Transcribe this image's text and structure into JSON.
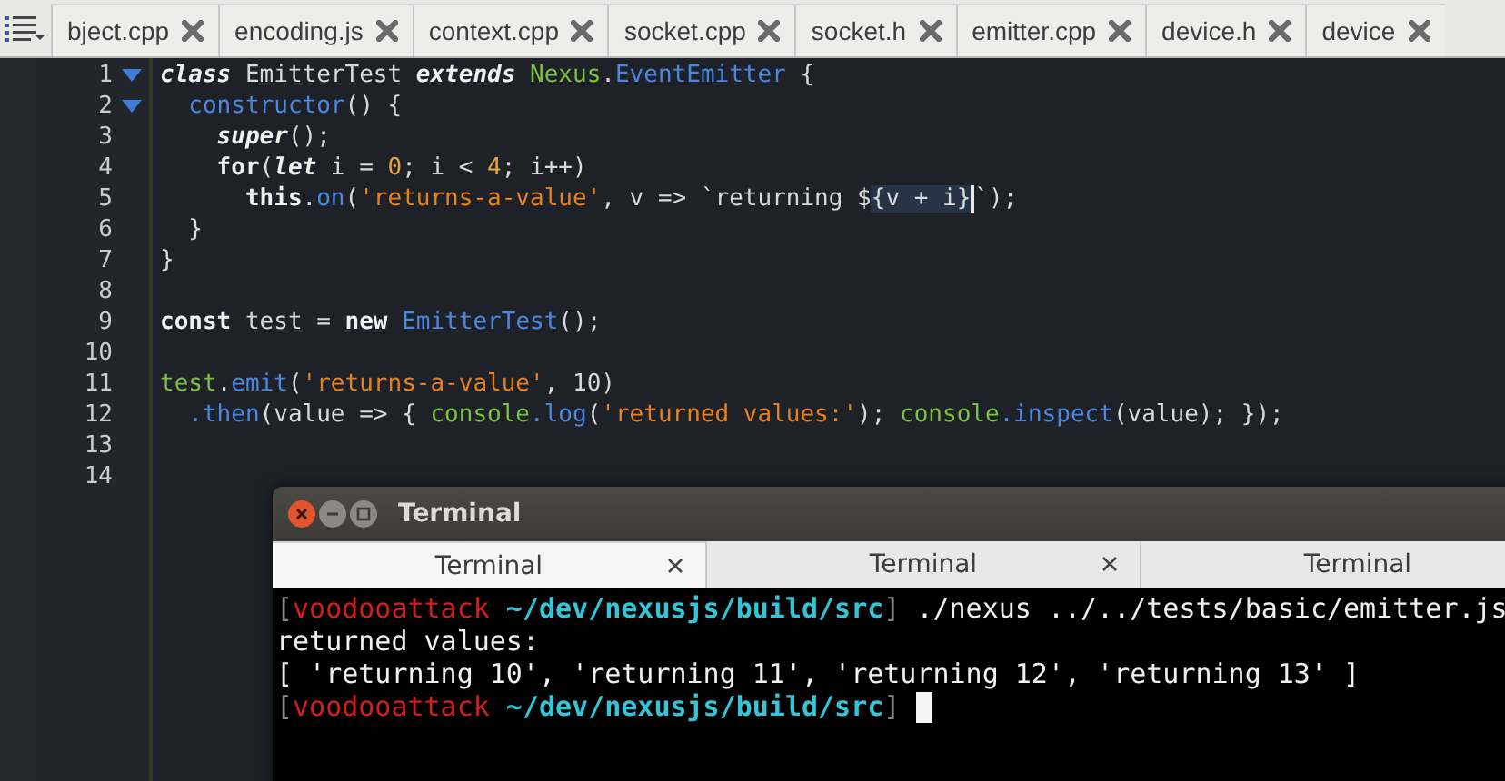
{
  "editor": {
    "tabs": [
      {
        "label": "bject.cpp"
      },
      {
        "label": "encoding.js"
      },
      {
        "label": "context.cpp"
      },
      {
        "label": "socket.cpp"
      },
      {
        "label": "socket.h"
      },
      {
        "label": "emitter.cpp"
      },
      {
        "label": "device.h"
      },
      {
        "label": "device"
      }
    ],
    "lines": [
      {
        "number": "1",
        "fold": true,
        "tokens": [
          {
            "kind": "keyword-italic",
            "text": "class"
          },
          {
            "kind": "plain",
            "text": " EmitterTest "
          },
          {
            "kind": "keyword-italic",
            "text": "extends "
          },
          {
            "kind": "object",
            "text": "Nexus"
          },
          {
            "kind": "plain",
            "text": "."
          },
          {
            "kind": "function",
            "text": "EventEmitter"
          },
          {
            "kind": "plain",
            "text": " {"
          }
        ]
      },
      {
        "number": "2",
        "fold": true,
        "tokens": [
          {
            "kind": "function",
            "text": "  constructor"
          },
          {
            "kind": "plain",
            "text": "() {"
          }
        ]
      },
      {
        "number": "3",
        "fold": false,
        "tokens": [
          {
            "kind": "keyword-italic",
            "text": "    super"
          },
          {
            "kind": "plain",
            "text": "();"
          }
        ]
      },
      {
        "number": "4",
        "fold": false,
        "tokens": [
          {
            "kind": "keyword",
            "text": "    for"
          },
          {
            "kind": "plain",
            "text": "("
          },
          {
            "kind": "keyword-italic",
            "text": "let"
          },
          {
            "kind": "plain",
            "text": " i = "
          },
          {
            "kind": "number",
            "text": "0"
          },
          {
            "kind": "plain",
            "text": "; i < "
          },
          {
            "kind": "number",
            "text": "4"
          },
          {
            "kind": "plain",
            "text": "; i++)"
          }
        ]
      },
      {
        "number": "5",
        "fold": false,
        "tokens": [
          {
            "kind": "keyword",
            "text": "      this"
          },
          {
            "kind": "plain",
            "text": "."
          },
          {
            "kind": "function",
            "text": "on"
          },
          {
            "kind": "plain",
            "text": "("
          },
          {
            "kind": "string",
            "text": "'returns-a-value'"
          },
          {
            "kind": "plain",
            "text": ", v => `returning $"
          },
          {
            "kind": "highlight",
            "text": "{v + i}"
          },
          {
            "kind": "plain",
            "text": "`);"
          }
        ]
      },
      {
        "number": "6",
        "fold": false,
        "tokens": [
          {
            "kind": "plain",
            "text": "  }"
          }
        ]
      },
      {
        "number": "7",
        "fold": false,
        "tokens": [
          {
            "kind": "plain",
            "text": "}"
          }
        ]
      },
      {
        "number": "8",
        "fold": false
      },
      {
        "number": "9",
        "fold": false,
        "tokens": [
          {
            "kind": "keyword",
            "text": "const"
          },
          {
            "kind": "plain",
            "text": " test = "
          },
          {
            "kind": "keyword",
            "text": "new "
          },
          {
            "kind": "function",
            "text": "EmitterTest"
          },
          {
            "kind": "plain",
            "text": "();"
          }
        ]
      },
      {
        "number": "10",
        "fold": false
      },
      {
        "number": "11",
        "fold": false,
        "tokens": [
          {
            "kind": "object",
            "text": "test"
          },
          {
            "kind": "plain",
            "text": "."
          },
          {
            "kind": "function",
            "text": "emit"
          },
          {
            "kind": "plain",
            "text": "("
          },
          {
            "kind": "string",
            "text": "'returns-a-value'"
          },
          {
            "kind": "plain",
            "text": ", 10)"
          }
        ]
      },
      {
        "number": "12",
        "fold": false,
        "tokens": [
          {
            "kind": "function",
            "text": "  .then"
          },
          {
            "kind": "plain",
            "text": "(value => { "
          },
          {
            "kind": "object",
            "text": "console"
          },
          {
            "kind": "function",
            "text": ".log"
          },
          {
            "kind": "plain",
            "text": "("
          },
          {
            "kind": "string",
            "text": "'returned values:'"
          },
          {
            "kind": "plain",
            "text": "); "
          },
          {
            "kind": "object",
            "text": "console"
          },
          {
            "kind": "function",
            "text": ".inspect"
          },
          {
            "kind": "plain",
            "text": "(value); });"
          }
        ]
      },
      {
        "number": "13",
        "fold": false
      },
      {
        "number": "14",
        "fold": false
      }
    ]
  },
  "terminal": {
    "title": "Terminal",
    "tabs": [
      {
        "label": "Terminal",
        "selected": true
      },
      {
        "label": "Terminal",
        "selected": false
      },
      {
        "label": "Terminal",
        "selected": false
      }
    ],
    "lines": [
      {
        "segments": [
          {
            "kind": "bracket",
            "text": "["
          },
          {
            "kind": "user",
            "text": "voodooattack"
          },
          {
            "kind": "path",
            "text": " ~/dev/nexusjs/build/src"
          },
          {
            "kind": "bracket",
            "text": "]"
          },
          {
            "kind": "output",
            "text": " ./nexus ../../tests/basic/emitter.js"
          }
        ]
      },
      {
        "segments": [
          {
            "kind": "output",
            "text": "returned values:"
          }
        ]
      },
      {
        "segments": [
          {
            "kind": "output",
            "text": "[ 'returning 10', 'returning 11', 'returning 12', 'returning 13' ]"
          }
        ]
      },
      {
        "segments": [
          {
            "kind": "bracket",
            "text": "["
          },
          {
            "kind": "user",
            "text": "voodooattack"
          },
          {
            "kind": "path",
            "text": " ~/dev/nexusjs/build/src"
          },
          {
            "kind": "bracket",
            "text": "]"
          }
        ]
      }
    ]
  }
}
